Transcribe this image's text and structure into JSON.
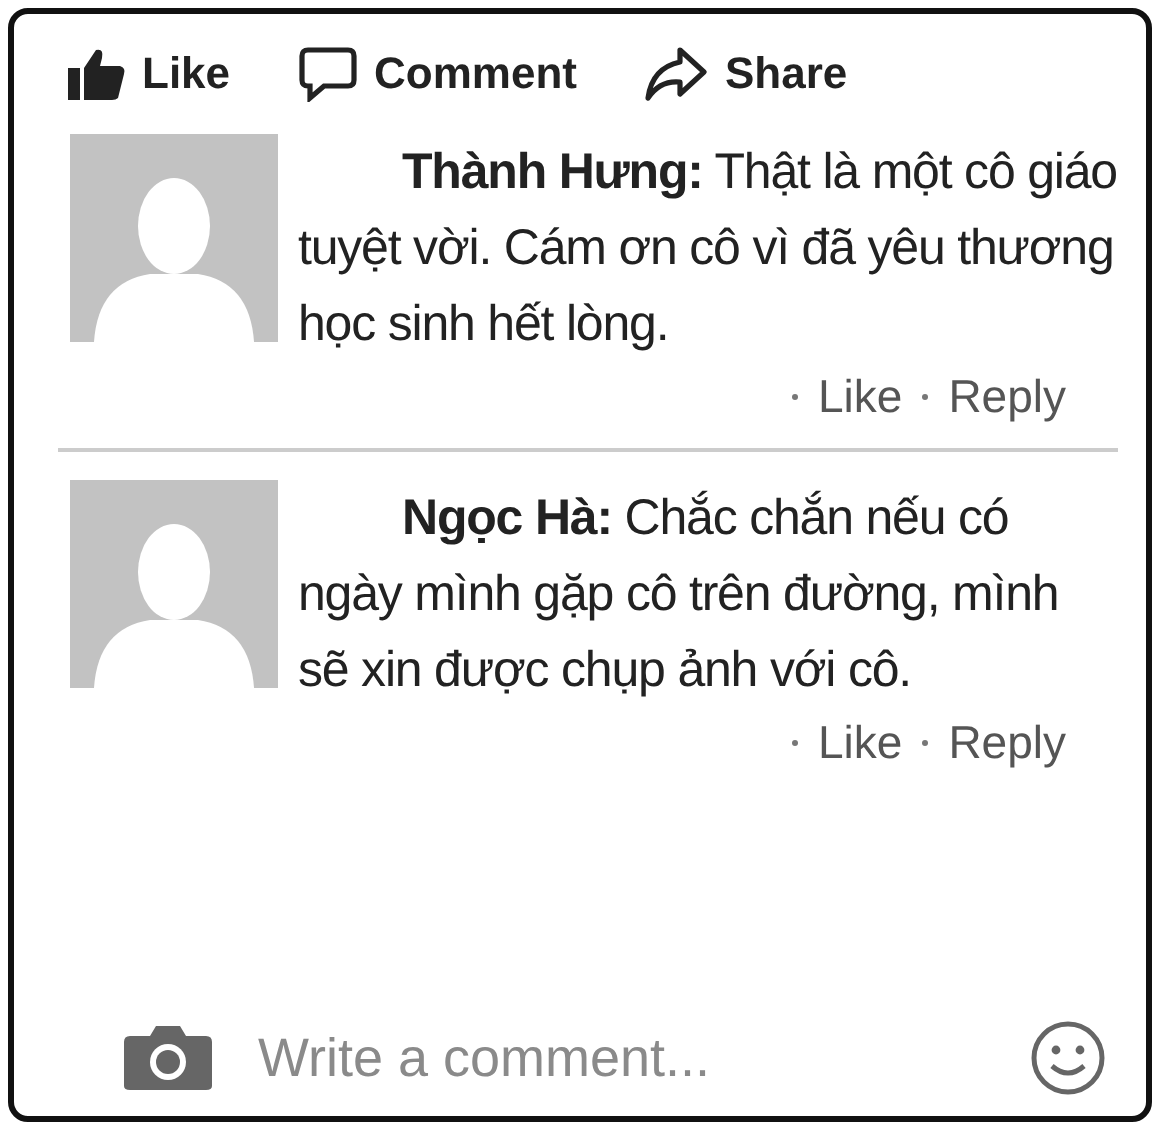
{
  "actions": [
    {
      "kind": "like",
      "label": "Like"
    },
    {
      "kind": "comment",
      "label": "Comment"
    },
    {
      "kind": "share",
      "label": "Share"
    }
  ],
  "comments": [
    {
      "text": "**Thành Hưng:** Thật là một cô giáo tuyệt vời. Cám ơn cô vì đã yêu thương học sinh hết lòng.",
      "links": [
        "Like",
        "Reply"
      ]
    },
    {
      "text": "**Ngọc Hà:** Chắc chắn nếu có ngày mình gặp cô trên đường, mình sẽ xin được chụp ảnh với cô.",
      "links": [
        "Like",
        "Reply"
      ]
    }
  ],
  "composer": {
    "placeholder": "Write a comment..."
  }
}
